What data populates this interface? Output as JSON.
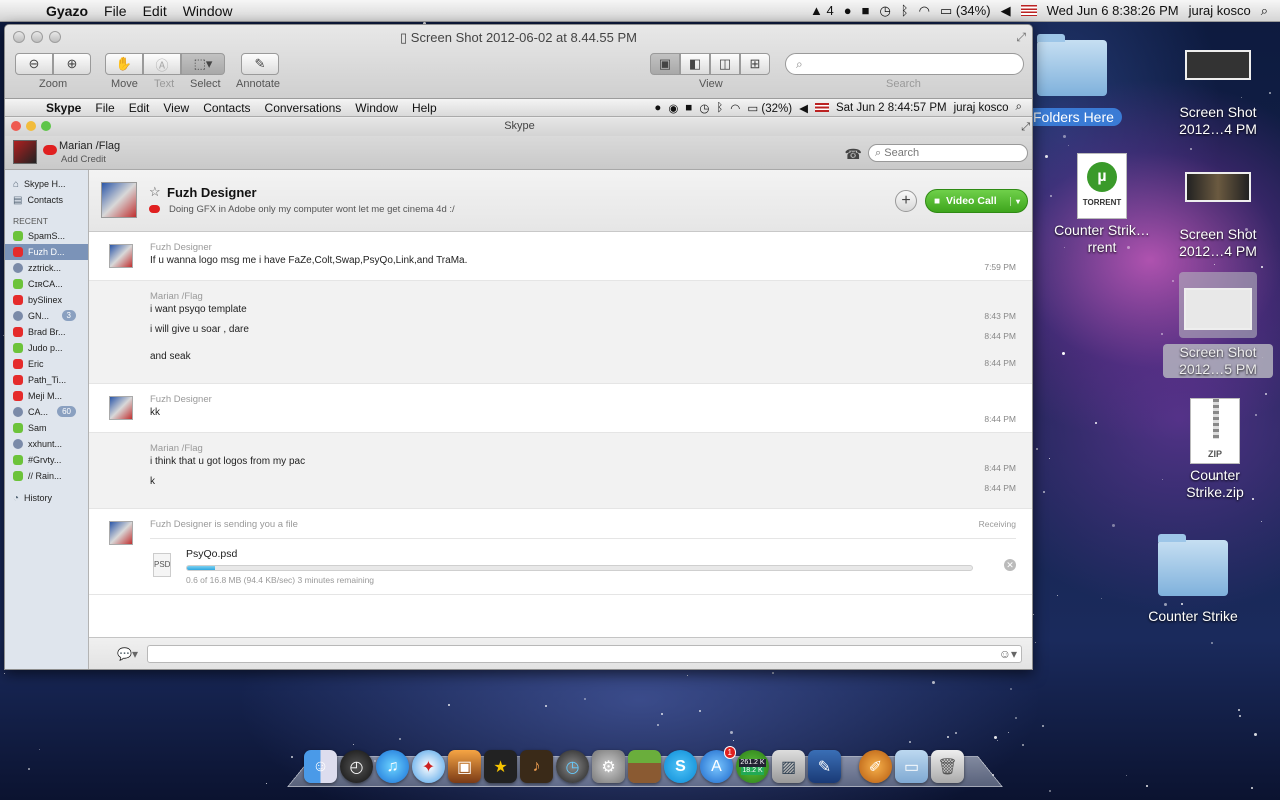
{
  "menubar": {
    "app": "Gyazo",
    "items": [
      "File",
      "Edit",
      "Window"
    ],
    "adobe_count": "4",
    "battery": "(34%)",
    "datetime": "Wed Jun 6  8:38:26 PM",
    "user": "juraj kosco"
  },
  "viewer": {
    "title": "Screen Shot 2012-06-02 at 8.44.55 PM",
    "zoom_label": "Zoom",
    "move_label": "Move",
    "text_label": "Text",
    "select_label": "Select",
    "annotate_label": "Annotate",
    "view_label": "View",
    "search_label": "Search"
  },
  "inner_menu": {
    "app": "Skype",
    "items": [
      "File",
      "Edit",
      "View",
      "Contacts",
      "Conversations",
      "Window",
      "Help"
    ],
    "battery": "(32%)",
    "datetime": "Sat Jun 2  8:44:57 PM",
    "user": "juraj kosco"
  },
  "skype": {
    "title": "Skype",
    "user_name": "Marian /Flag",
    "add_credit": "Add Credit",
    "search_placeholder": "Search",
    "sidebar": {
      "top": [
        {
          "label": "Skype H...",
          "icon": "home-icon"
        },
        {
          "label": "Contacts",
          "icon": "contacts-icon"
        }
      ],
      "recent_header": "RECENT",
      "recent": [
        {
          "label": "SpamS...",
          "status": "g"
        },
        {
          "label": "Fuzh D...",
          "status": "r"
        },
        {
          "label": "zztrick...",
          "status": "b"
        },
        {
          "label": "CɪʀCA...",
          "status": "g"
        },
        {
          "label": "bySlinex",
          "status": "r"
        },
        {
          "label": "GN...",
          "status": "b",
          "badge": "3"
        },
        {
          "label": "Brad Br...",
          "status": "r"
        },
        {
          "label": "Judo p...",
          "status": "g"
        },
        {
          "label": "Eric",
          "status": "r"
        },
        {
          "label": "Path_Ti...",
          "status": "r"
        },
        {
          "label": "Meji M...",
          "status": "r"
        },
        {
          "label": "CA...",
          "status": "b",
          "badge": "60"
        },
        {
          "label": "Sam",
          "status": "g"
        },
        {
          "label": "xxhunt...",
          "status": "b"
        },
        {
          "label": "#Grvty...",
          "status": "g"
        },
        {
          "label": "// Rain...",
          "status": "g"
        }
      ],
      "history": "History"
    },
    "chat": {
      "contact_name": "Fuzh Designer",
      "mood": "Doing GFX in Adobe only my computer wont let me get cinema 4d :/",
      "video_call": "Video Call",
      "groups": [
        {
          "author": "Fuzh Designer",
          "avatar": true,
          "alt": false,
          "lines": [
            {
              "text": "If u wanna logo msg me i have FaZe,Colt,Swap,PsyQo,Link,and TraMa.",
              "time": "7:59 PM"
            }
          ]
        },
        {
          "author": "Marian /Flag",
          "avatar": false,
          "alt": true,
          "lines": [
            {
              "text": "i want psyqo template",
              "time": "8:43 PM"
            },
            {
              "text": "i will give u soar , dare",
              "time": "8:44 PM"
            },
            {
              "text": "and seak",
              "time": "8:44 PM"
            }
          ]
        },
        {
          "author": "Fuzh Designer",
          "avatar": true,
          "alt": false,
          "lines": [
            {
              "text": "kk",
              "time": "8:44 PM"
            }
          ]
        },
        {
          "author": "Marian /Flag",
          "avatar": false,
          "alt": true,
          "lines": [
            {
              "text": "i think that u got logos from my pac",
              "time": "8:44 PM"
            },
            {
              "text": "k",
              "time": "8:44 PM"
            }
          ]
        }
      ],
      "file_transfer": {
        "header": "Fuzh Designer is sending you a file",
        "status": "Receiving",
        "file_name": "PsyQo.psd",
        "progress_text": "0.6 of 16.8 MB (94.4 KB/sec) 3 minutes remaining",
        "progress_fraction": 0.036
      }
    }
  },
  "desktop": {
    "folders_here": "Folders Here",
    "icons": [
      {
        "label": "Screen Shot 2012…4 PM",
        "kind": "thumb"
      },
      {
        "label": "Counter Strik…rrent",
        "kind": "torrent"
      },
      {
        "label": "Screen Shot 2012…4 PM",
        "kind": "thumb"
      },
      {
        "label": "Screen Shot 2012…5 PM",
        "kind": "thumb-selected"
      },
      {
        "label": "Counter Strike.zip",
        "kind": "zip"
      },
      {
        "label": "Counter Strike",
        "kind": "folder"
      }
    ],
    "torrent_word": "TORRENT",
    "zip_word": "ZIP"
  },
  "dock": {
    "appstore_badge": "1",
    "utorrent_down": "261.2 K",
    "utorrent_up": "18.2 K"
  }
}
